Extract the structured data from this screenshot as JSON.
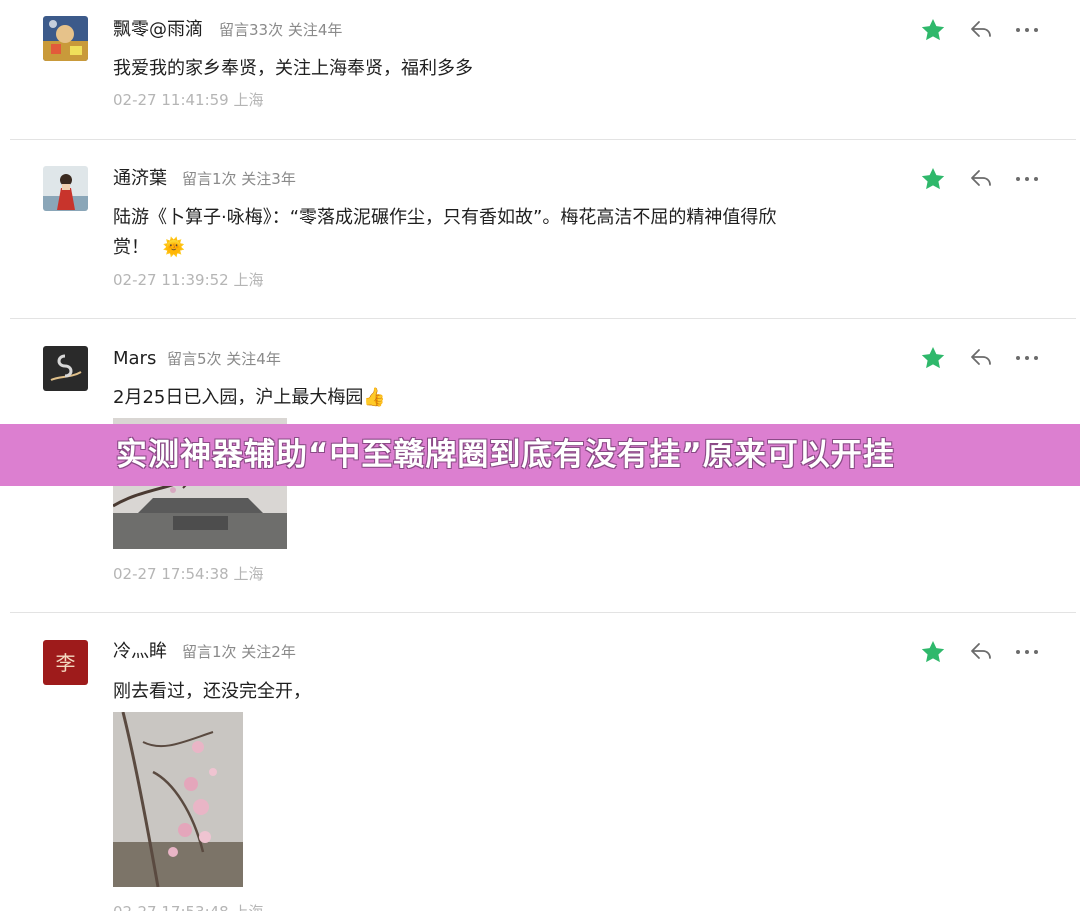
{
  "comments": [
    {
      "name": "飘零@雨滴",
      "meta": "留言33次 关注4年",
      "text": "我爱我的家乡奉贤，关注上海奉贤，福利多多",
      "time": "02-27 11:41:59 上海"
    },
    {
      "name": "通济葉",
      "meta": "留言1次 关注3年",
      "text_line1": "陆游《卜算子·咏梅》：“零落成泥碾作尘，只有香如故”。梅花高洁不屈的精神值得欣",
      "text_line2": "赏！",
      "emoji": "🌞",
      "time": "02-27 11:39:52 上海"
    },
    {
      "name": "Mars",
      "meta": "留言5次 关注4年",
      "text": "2月25日已入园，沪上最大梅园",
      "emoji": "👍",
      "time": "02-27 17:54:38 上海"
    },
    {
      "name": "冷灬眸",
      "meta": "留言1次 关注2年",
      "text": "刚去看过，还没完全开，",
      "avatar_char": "李",
      "time": "02-27 17:53:48 上海"
    }
  ],
  "banner": {
    "text": "实测神器辅助“中至赣牌圈到底有没有挂”原来可以开挂"
  },
  "colors": {
    "star": "#2fb86b",
    "banner": "#dc7fd0",
    "time": "#b5b5b5",
    "meta": "#8a8a8a"
  },
  "icons": [
    "star-icon",
    "reply-icon",
    "more-icon"
  ]
}
